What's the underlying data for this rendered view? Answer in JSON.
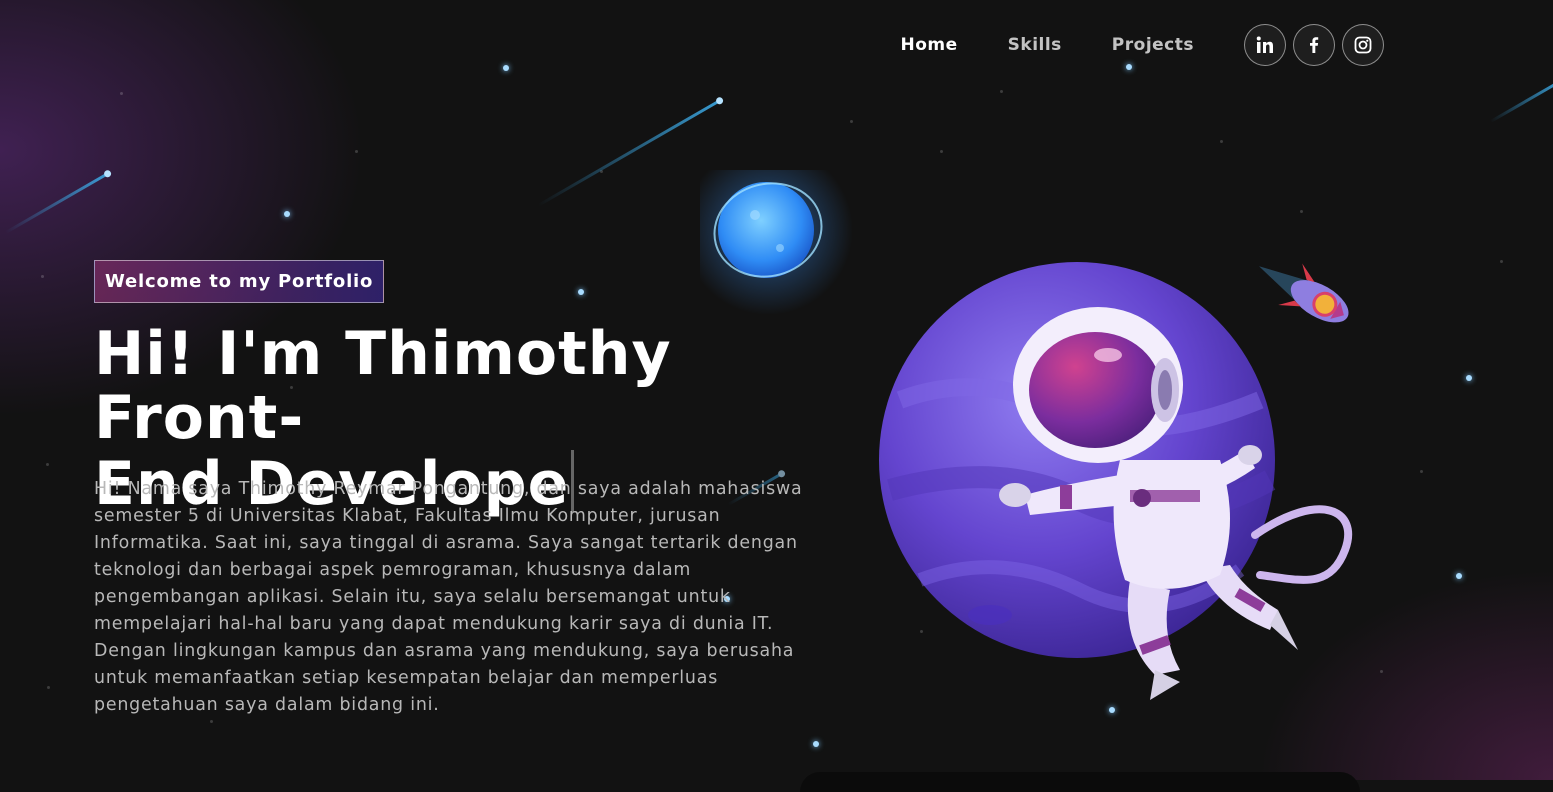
{
  "nav": {
    "links": [
      {
        "label": "Home",
        "active": true
      },
      {
        "label": "Skills",
        "active": false
      },
      {
        "label": "Projects",
        "active": false
      }
    ],
    "socials": [
      "linkedin-icon",
      "facebook-icon",
      "instagram-icon"
    ]
  },
  "hero": {
    "tagline": "Welcome to my Portfolio",
    "heading_line1": "Hi! I'm Thimothy Front-",
    "heading_line2": "End Develope",
    "bio": "Hi! Nama saya Thimothy Reymar Pongantung, dan saya adalah mahasiswa semester 5 di Universitas Klabat, Fakultas Ilmu Komputer, jurusan Informatika. Saat ini, saya tinggal di asrama. Saya sangat tertarik dengan teknologi dan berbagai aspek pemrograman, khususnya dalam pengembangan aplikasi. Selain itu, saya selalu bersemangat untuk mempelajari hal-hal baru yang dapat mendukung karir saya di dunia IT. Dengan lingkungan kampus dan asrama yang mendukung, saya berusaha untuk memanfaatkan setiap kesempatan belajar dan memperluas pengetahuan saya dalam bidang ini."
  },
  "colors": {
    "background": "#121212",
    "accent_pink": "#aa367c",
    "accent_purple": "#4a2fbd",
    "planet": "#6b4fd6"
  }
}
